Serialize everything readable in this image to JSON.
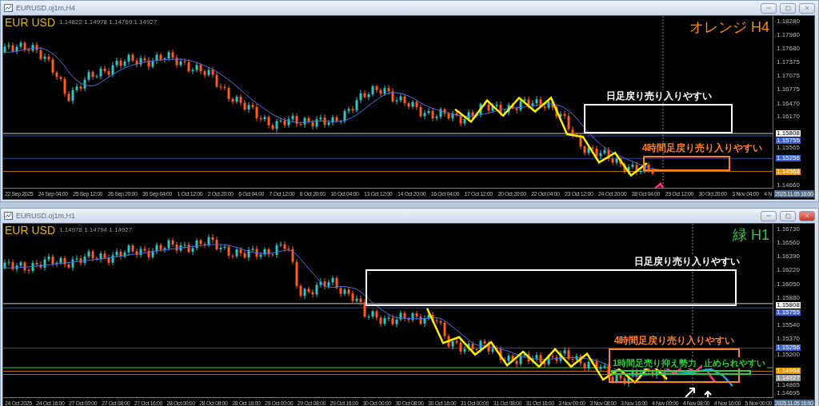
{
  "windows": [
    {
      "title": "EURUSD.oj1m,H4",
      "active": false,
      "quote": "1.14822 1.14978 1.14769 1.14927",
      "symbol_label": "EUR USD",
      "timeframe_label": "オレンジ H4",
      "price_ticks": [
        "1.18280",
        "1.17980",
        "1.17680",
        "1.17375",
        "1.17075",
        "1.16775",
        "1.16470",
        "1.16170",
        "1.15565",
        "1.14660"
      ],
      "price_tags": [
        {
          "price": "1.15808",
          "color": "#ffffff"
        },
        {
          "price": "1.15755",
          "color": "#3a5fcd"
        },
        {
          "price": "1.15256",
          "color": "#3a5fcd"
        },
        {
          "price": "1.14968",
          "color": "#e69500"
        }
      ],
      "time_labels": [
        "22 Sep 2025",
        "24 Sep 04:00",
        "25 Sep 12:00",
        "26 Sep 20:00",
        "30 Sep 04:00",
        "1 Oct 12:00",
        "2 Oct 20:00",
        "6 Oct 04:00",
        "7 Oct 12:00",
        "8 Oct 20:00",
        "10 Oct 04:00",
        "13 Oct 12:00",
        "14 Oct 20:00",
        "16 Oct 04:00",
        "17 Oct 12:00",
        "20 Oct 20:00",
        "22 Oct 04:00",
        "23 Oct 12:00",
        "24 Oct 20:00",
        "28 Oct 04:00",
        "29 Oct 12:00",
        "30 Oct 20:00",
        "3 Nov 04:00",
        "4 N"
      ],
      "cursor_time": "2025.11.05 16:00",
      "zones": [
        {
          "label": "日足戻り売り入りやすい",
          "color": "#ffffff"
        },
        {
          "label": "4時間足戻り売り入りやすい",
          "color": "#ff7f27"
        }
      ]
    },
    {
      "title": "EURUSD.oj1m,H1",
      "active": true,
      "quote": "1.14978 1.14794 1.14927",
      "symbol_label": "EUR USD",
      "timeframe_label": "緑 H1",
      "price_ticks": [
        "1.16730",
        "1.16560",
        "1.16390",
        "1.16220",
        "1.16050",
        "1.15880",
        "1.15540",
        "1.15370",
        "1.15200",
        "1.14865",
        "1.14695"
      ],
      "price_tags": [
        {
          "price": "1.15808",
          "color": "#ffffff"
        },
        {
          "price": "1.15755",
          "color": "#3a5fcd"
        },
        {
          "price": "1.15256",
          "color": "#3a5fcd"
        },
        {
          "price": "1.14968",
          "color": "#e69500"
        },
        {
          "price": "1.14927",
          "color": "#9a9a9a"
        }
      ],
      "time_labels": [
        "24 Oct 2025",
        "24 Oct 16:00",
        "27 Oct 00:00",
        "27 Oct 08:00",
        "27 Oct 16:00",
        "28 Oct 00:00",
        "28 Oct 08:00",
        "28 Oct 16:00",
        "29 Oct 00:00",
        "29 Oct 08:00",
        "29 Oct 16:00",
        "30 Oct 00:00",
        "30 Oct 08:00",
        "30 Oct 16:00",
        "31 Oct 00:00",
        "31 Oct 08:00",
        "31 Oct 16:00",
        "3 Nov 00:00",
        "3 Nov 08:00",
        "3 Nov 16:00",
        "4 Nov 00:00",
        "4 Nov 08:00",
        "4 Nov 16:00",
        "5 Nov 00:00"
      ],
      "cursor_time": "2025.11.05 16:00",
      "zones": [
        {
          "label": "日足戻り売り入りやすい",
          "color": "#ffffff"
        },
        {
          "label": "4時間足戻り売り入りやすい",
          "color": "#ff7f27"
        },
        {
          "label": "1時間足売り抑え勢力",
          "note": "止められやすい",
          "color": "#2ecc40"
        }
      ]
    }
  ]
}
